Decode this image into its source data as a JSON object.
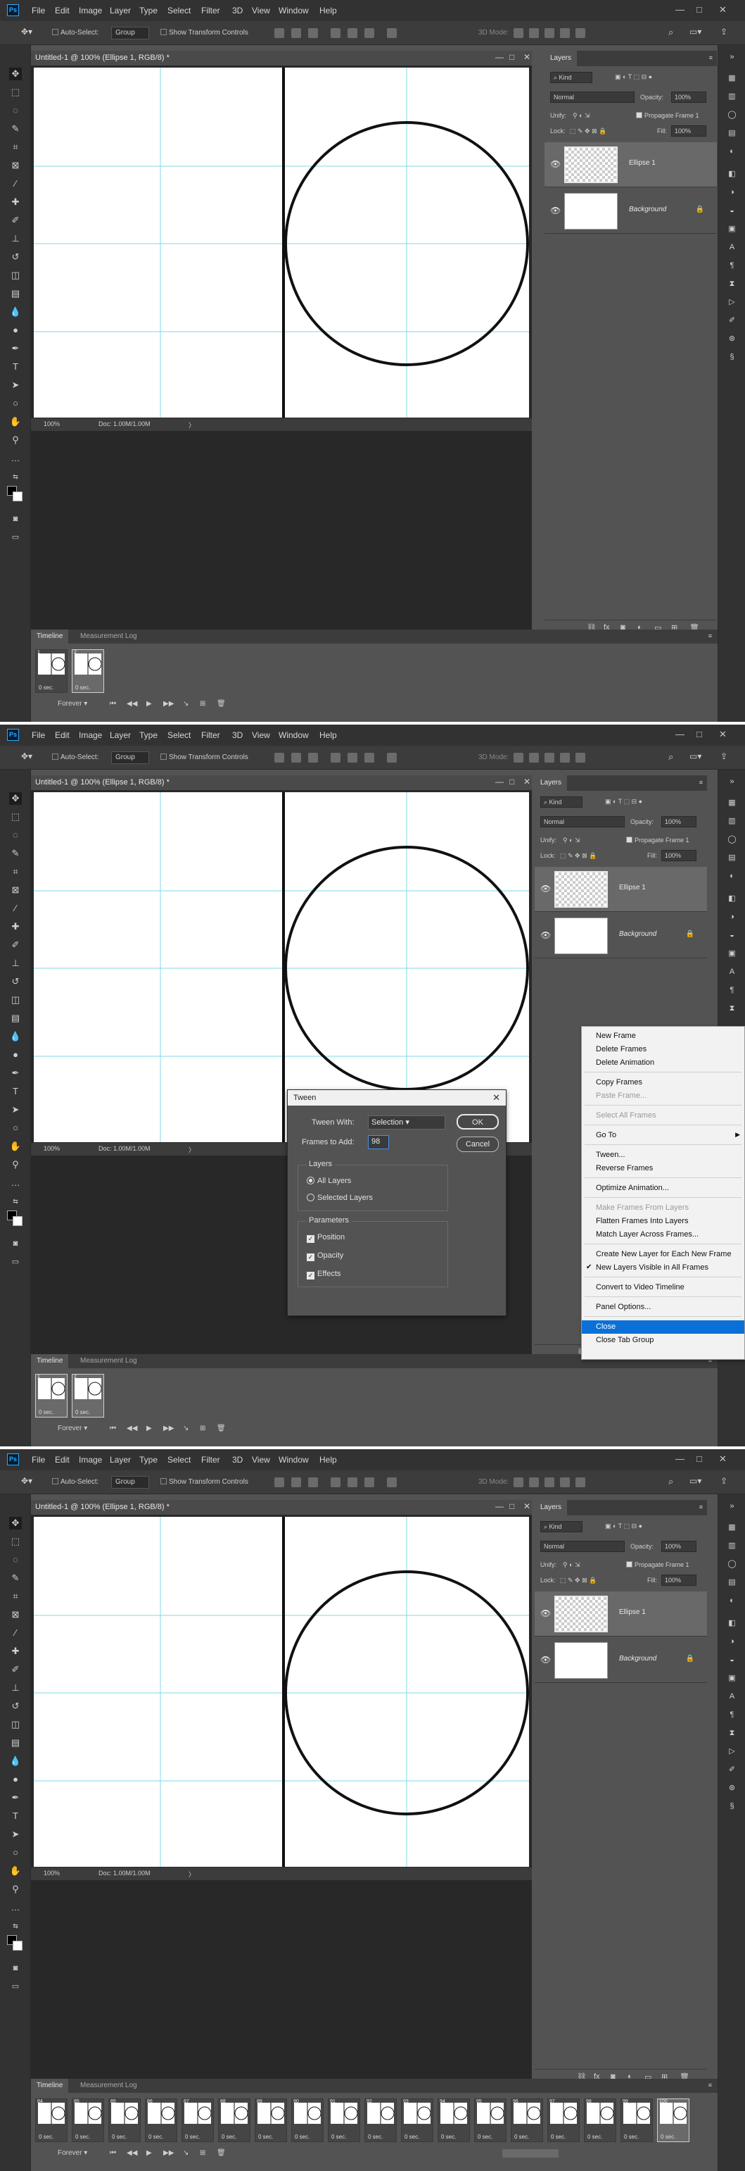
{
  "menu": {
    "logo": "Ps",
    "items": [
      "File",
      "Edit",
      "Image",
      "Layer",
      "Type",
      "Select",
      "Filter",
      "3D",
      "View",
      "Window",
      "Help"
    ],
    "minimize": "—",
    "maximize": "□",
    "close": "✕"
  },
  "options": {
    "auto_select": "Auto-Select:",
    "group": "Group",
    "show_transform": "Show Transform Controls",
    "mode_3d": "3D Mode:"
  },
  "document": {
    "title": "Untitled-1 @ 100% (Ellipse 1, RGB/8) *",
    "zoom": "100%",
    "doc_info": "Doc: 1.00M/1.00M",
    "arrow": "〉"
  },
  "layers": {
    "tab": "Layers",
    "kind": "Kind",
    "blend": "Normal",
    "opacity_label": "Opacity:",
    "opacity": "100%",
    "unify_label": "Unify:",
    "propagate": "Propagate Frame 1",
    "lock_label": "Lock:",
    "fill_label": "Fill:",
    "fill": "100%",
    "layer_1": "Ellipse 1",
    "layer_2": "Background"
  },
  "timeline": {
    "tab_timeline": "Timeline",
    "tab_measurement": "Measurement Log",
    "loop": "Forever",
    "delay": "0 sec.",
    "frames_shot3": [
      "84",
      "85",
      "85",
      "86",
      "87",
      "88",
      "89",
      "90",
      "91",
      "92",
      "93",
      "94",
      "95",
      "96",
      "97",
      "98",
      "99",
      "100"
    ]
  },
  "tween": {
    "title": "Tween",
    "tween_with_label": "Tween With:",
    "tween_with_value": "Selection",
    "frames_label": "Frames to Add:",
    "frames_value": "98",
    "ok": "OK",
    "cancel": "Cancel",
    "layers_group": "Layers",
    "all_layers": "All Layers",
    "selected_layers": "Selected Layers",
    "params_group": "Parameters",
    "position": "Position",
    "opacity": "Opacity",
    "effects": "Effects"
  },
  "context_menu": {
    "new_frame": "New Frame",
    "delete_frames": "Delete Frames",
    "delete_animation": "Delete Animation",
    "copy_frames": "Copy Frames",
    "paste_frame": "Paste Frame...",
    "select_all": "Select All Frames",
    "go_to": "Go To",
    "tween": "Tween...",
    "reverse": "Reverse Frames",
    "optimize": "Optimize Animation...",
    "make_frames": "Make Frames From Layers",
    "flatten": "Flatten Frames Into Layers",
    "match_layer": "Match Layer Across Frames...",
    "create_layer": "Create New Layer for Each New Frame",
    "new_layers_visible": "New Layers Visible in All Frames",
    "convert": "Convert to Video Timeline",
    "panel_options": "Panel Options...",
    "close": "Close",
    "close_tab_group": "Close Tab Group"
  }
}
